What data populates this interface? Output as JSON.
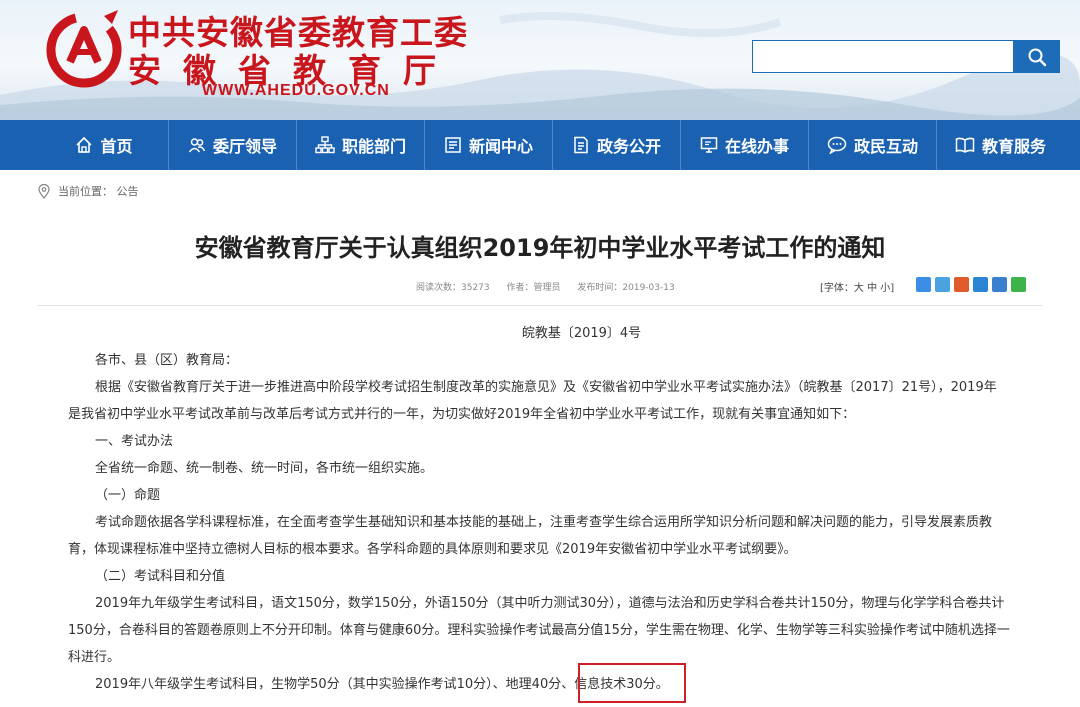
{
  "header": {
    "title_line1": "中共安徽省委教育工委",
    "title_line2": "安徽省教育厅",
    "url": "WWW.AHEDU.GOV.CN",
    "brand_color": "#c9161d"
  },
  "search": {
    "placeholder": "",
    "value": "",
    "button_icon": "search-icon"
  },
  "nav": {
    "color": "#1a62b1",
    "items": [
      {
        "label": "首页",
        "icon": "home-icon"
      },
      {
        "label": "委厅领导",
        "icon": "leaders-icon"
      },
      {
        "label": "职能部门",
        "icon": "org-chart-icon"
      },
      {
        "label": "新闻中心",
        "icon": "news-icon"
      },
      {
        "label": "政务公开",
        "icon": "document-icon"
      },
      {
        "label": "在线办事",
        "icon": "monitor-icon"
      },
      {
        "label": "政民互动",
        "icon": "chat-icon"
      },
      {
        "label": "教育服务",
        "icon": "book-icon"
      }
    ]
  },
  "breadcrumb": {
    "text": "当前位置：  公告"
  },
  "article": {
    "title": "安徽省教育厅关于认真组织2019年初中学业水平考试工作的通知",
    "meta": {
      "views": "阅读次数：35273",
      "author": "作者：管理员",
      "date": "发布时间：2019-03-13"
    },
    "fontsize_label": "[字体：大 中 小]",
    "share_colors": [
      "#3a8ee6",
      "#4aa3df",
      "#e05b2b",
      "#2a86d5",
      "#3b7fd0",
      "#3db34a"
    ],
    "doc_no": "皖教基〔2019〕4号",
    "paragraphs": [
      "各市、县（区）教育局：",
      "根据《安徽省教育厅关于进一步推进高中阶段学校考试招生制度改革的实施意见》及《安徽省初中学业水平考试实施办法》（皖教基〔2017〕21号），2019年",
      "是我省初中学业水平考试改革前与改革后考试方式并行的一年，为切实做好2019年全省初中学业水平考试工作，现就有关事宜通知如下：",
      "一、考试办法",
      "全省统一命题、统一制卷、统一时间，各市统一组织实施。",
      "（一）命题",
      "考试命题依据各学科课程标准，在全面考查学生基础知识和基本技能的基础上，注重考查学生综合运用所学知识分析问题和解决问题的能力，引导发展素质教",
      "育，体现课程标准中坚持立德树人目标的根本要求。各学科命题的具体原则和要求见《2019年安徽省初中学业水平考试纲要》。",
      "（二）考试科目和分值",
      "2019年九年级学生考试科目，语文150分，数学150分，外语150分（其中听力测试30分），道德与法治和历史学科合卷共计150分，物理与化学学科合卷共计",
      "150分，合卷科目的答题卷原则上不分开印制。体育与健康60分。理科实验操作考试最高分值15分，学生需在物理、化学、生物学等三科实验操作考试中随机选择一",
      "科进行。",
      "2019年八年级学生考试科目，生物学50分（其中实验操作考试10分）、地理40分、信息技术30分。"
    ]
  }
}
